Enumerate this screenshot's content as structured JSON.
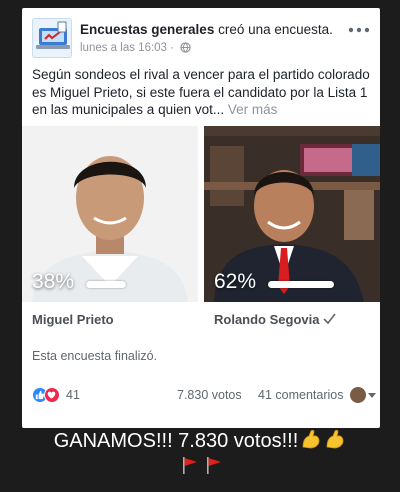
{
  "post": {
    "author": "Encuestas generales",
    "action": "creó una encuesta.",
    "timestamp": "lunes a las 16:03",
    "text": "Según sondeos el rival a vencer para el partido colorado es Miguel Prieto, si este fuera el candidato por la Lista 1 en las municipales a quien vot...",
    "see_more": "Ver más"
  },
  "poll": {
    "options": [
      {
        "name": "Miguel Prieto",
        "percent_label": "38%",
        "percent": 38
      },
      {
        "name": "Rolando Segovia",
        "percent_label": "62%",
        "percent": 62
      }
    ],
    "status": "Esta encuesta finalizó."
  },
  "footer": {
    "reaction_count": "41",
    "votes": "7.830 votos",
    "comments": "41 comentarios"
  },
  "caption": {
    "text": "GANAMOS!!! 7.830 votos!!!"
  },
  "icons": {
    "like": "like-reaction-icon",
    "love": "love-reaction-icon",
    "globe": "globe-icon",
    "check": "checkmark-icon",
    "arm": "flexed-biceps-emoji",
    "flag": "red-triangular-flag-emoji"
  },
  "colors": {
    "accent": "#2d88ff",
    "love": "#f0284a",
    "flag": "#e0201b",
    "biceps": "#f7c42d"
  }
}
